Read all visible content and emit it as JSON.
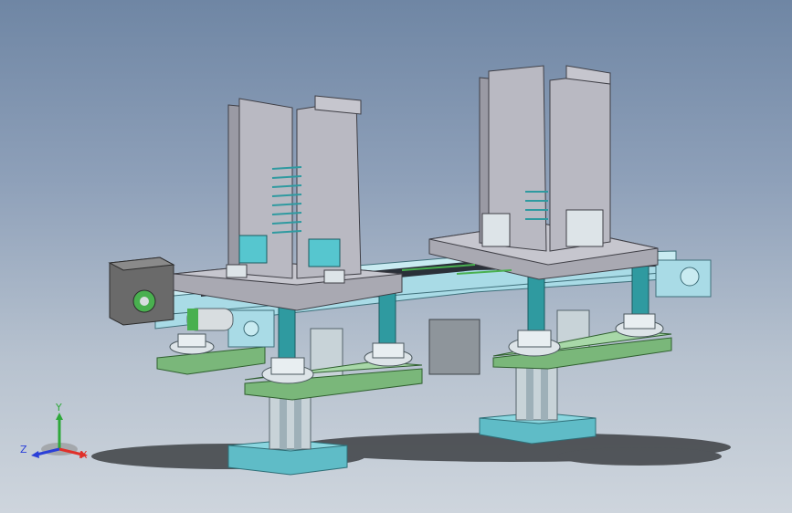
{
  "viewport": {
    "background_top": "#6f86a4",
    "background_bottom": "#ced5dd"
  },
  "model": {
    "parts": [
      "stepper-motor",
      "conveyor-belt",
      "left-magazine",
      "right-magazine",
      "support-columns",
      "base-plates"
    ],
    "colors": {
      "sheet_metal": "#a9a9b2",
      "frame": "#a9dbe6",
      "column": "#2f9aa0",
      "mount_plate": "#7ab77a",
      "base": "#5fbcc7",
      "belt": "#2a2f38",
      "motor": "#6a6a6a"
    }
  },
  "triad": {
    "x_label": "X",
    "y_label": "Y",
    "z_label": "Z",
    "x_color": "#e0302a",
    "y_color": "#2ea83a",
    "z_color": "#2a3fd8"
  }
}
